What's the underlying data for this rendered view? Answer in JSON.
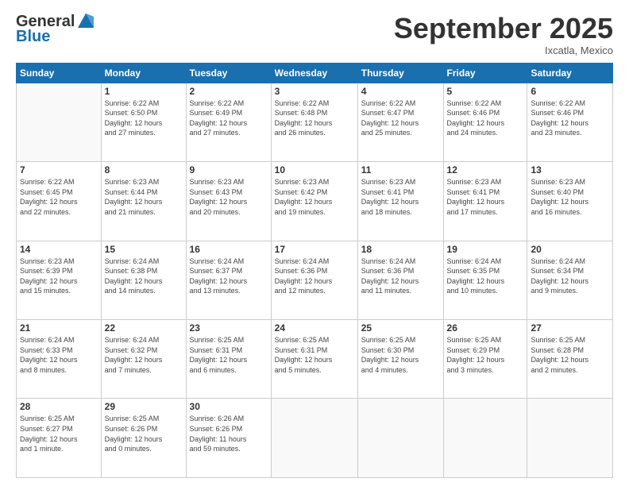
{
  "header": {
    "logo_line1": "General",
    "logo_line2": "Blue",
    "month": "September 2025",
    "location": "Ixcatla, Mexico"
  },
  "weekdays": [
    "Sunday",
    "Monday",
    "Tuesday",
    "Wednesday",
    "Thursday",
    "Friday",
    "Saturday"
  ],
  "weeks": [
    [
      {
        "day": "",
        "info": ""
      },
      {
        "day": "1",
        "info": "Sunrise: 6:22 AM\nSunset: 6:50 PM\nDaylight: 12 hours\nand 27 minutes."
      },
      {
        "day": "2",
        "info": "Sunrise: 6:22 AM\nSunset: 6:49 PM\nDaylight: 12 hours\nand 27 minutes."
      },
      {
        "day": "3",
        "info": "Sunrise: 6:22 AM\nSunset: 6:48 PM\nDaylight: 12 hours\nand 26 minutes."
      },
      {
        "day": "4",
        "info": "Sunrise: 6:22 AM\nSunset: 6:47 PM\nDaylight: 12 hours\nand 25 minutes."
      },
      {
        "day": "5",
        "info": "Sunrise: 6:22 AM\nSunset: 6:46 PM\nDaylight: 12 hours\nand 24 minutes."
      },
      {
        "day": "6",
        "info": "Sunrise: 6:22 AM\nSunset: 6:46 PM\nDaylight: 12 hours\nand 23 minutes."
      }
    ],
    [
      {
        "day": "7",
        "info": "Sunrise: 6:22 AM\nSunset: 6:45 PM\nDaylight: 12 hours\nand 22 minutes."
      },
      {
        "day": "8",
        "info": "Sunrise: 6:23 AM\nSunset: 6:44 PM\nDaylight: 12 hours\nand 21 minutes."
      },
      {
        "day": "9",
        "info": "Sunrise: 6:23 AM\nSunset: 6:43 PM\nDaylight: 12 hours\nand 20 minutes."
      },
      {
        "day": "10",
        "info": "Sunrise: 6:23 AM\nSunset: 6:42 PM\nDaylight: 12 hours\nand 19 minutes."
      },
      {
        "day": "11",
        "info": "Sunrise: 6:23 AM\nSunset: 6:41 PM\nDaylight: 12 hours\nand 18 minutes."
      },
      {
        "day": "12",
        "info": "Sunrise: 6:23 AM\nSunset: 6:41 PM\nDaylight: 12 hours\nand 17 minutes."
      },
      {
        "day": "13",
        "info": "Sunrise: 6:23 AM\nSunset: 6:40 PM\nDaylight: 12 hours\nand 16 minutes."
      }
    ],
    [
      {
        "day": "14",
        "info": "Sunrise: 6:23 AM\nSunset: 6:39 PM\nDaylight: 12 hours\nand 15 minutes."
      },
      {
        "day": "15",
        "info": "Sunrise: 6:24 AM\nSunset: 6:38 PM\nDaylight: 12 hours\nand 14 minutes."
      },
      {
        "day": "16",
        "info": "Sunrise: 6:24 AM\nSunset: 6:37 PM\nDaylight: 12 hours\nand 13 minutes."
      },
      {
        "day": "17",
        "info": "Sunrise: 6:24 AM\nSunset: 6:36 PM\nDaylight: 12 hours\nand 12 minutes."
      },
      {
        "day": "18",
        "info": "Sunrise: 6:24 AM\nSunset: 6:36 PM\nDaylight: 12 hours\nand 11 minutes."
      },
      {
        "day": "19",
        "info": "Sunrise: 6:24 AM\nSunset: 6:35 PM\nDaylight: 12 hours\nand 10 minutes."
      },
      {
        "day": "20",
        "info": "Sunrise: 6:24 AM\nSunset: 6:34 PM\nDaylight: 12 hours\nand 9 minutes."
      }
    ],
    [
      {
        "day": "21",
        "info": "Sunrise: 6:24 AM\nSunset: 6:33 PM\nDaylight: 12 hours\nand 8 minutes."
      },
      {
        "day": "22",
        "info": "Sunrise: 6:24 AM\nSunset: 6:32 PM\nDaylight: 12 hours\nand 7 minutes."
      },
      {
        "day": "23",
        "info": "Sunrise: 6:25 AM\nSunset: 6:31 PM\nDaylight: 12 hours\nand 6 minutes."
      },
      {
        "day": "24",
        "info": "Sunrise: 6:25 AM\nSunset: 6:31 PM\nDaylight: 12 hours\nand 5 minutes."
      },
      {
        "day": "25",
        "info": "Sunrise: 6:25 AM\nSunset: 6:30 PM\nDaylight: 12 hours\nand 4 minutes."
      },
      {
        "day": "26",
        "info": "Sunrise: 6:25 AM\nSunset: 6:29 PM\nDaylight: 12 hours\nand 3 minutes."
      },
      {
        "day": "27",
        "info": "Sunrise: 6:25 AM\nSunset: 6:28 PM\nDaylight: 12 hours\nand 2 minutes."
      }
    ],
    [
      {
        "day": "28",
        "info": "Sunrise: 6:25 AM\nSunset: 6:27 PM\nDaylight: 12 hours\nand 1 minute."
      },
      {
        "day": "29",
        "info": "Sunrise: 6:25 AM\nSunset: 6:26 PM\nDaylight: 12 hours\nand 0 minutes."
      },
      {
        "day": "30",
        "info": "Sunrise: 6:26 AM\nSunset: 6:26 PM\nDaylight: 11 hours\nand 59 minutes."
      },
      {
        "day": "",
        "info": ""
      },
      {
        "day": "",
        "info": ""
      },
      {
        "day": "",
        "info": ""
      },
      {
        "day": "",
        "info": ""
      }
    ]
  ]
}
